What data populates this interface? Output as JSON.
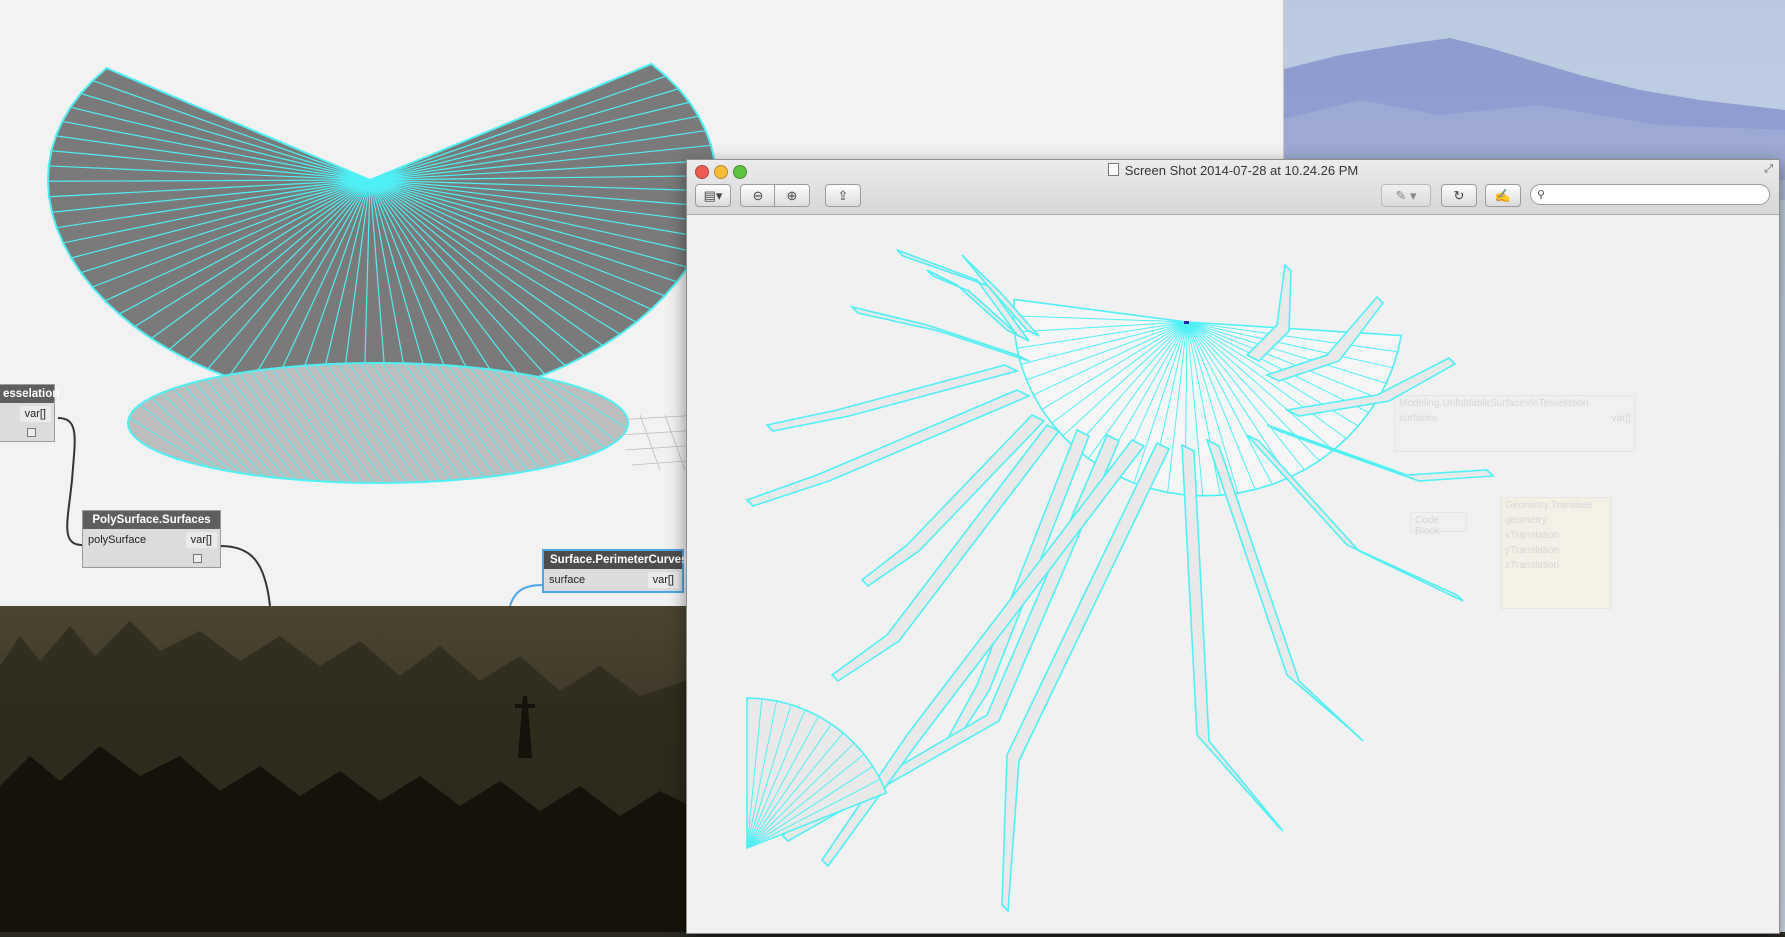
{
  "dynamo": {
    "nodes": {
      "tesselation": {
        "title": "esselation",
        "output": "var[]"
      },
      "polysurface": {
        "title": "PolySurface.Surfaces",
        "input": "polySurface",
        "output": "var[]"
      },
      "perimeter": {
        "title": "Surface.PerimeterCurves",
        "input": "surface",
        "output": "var[]"
      }
    }
  },
  "preview": {
    "window_title": "Screen Shot 2014-07-28 at 10.24.26 PM",
    "toolbar": {
      "sidebar_icon": "sidebar-icon",
      "zoom_out_icon": "zoom-out-icon",
      "zoom_in_icon": "zoom-in-icon",
      "share_icon": "share-icon",
      "annotate_icon": "pen-icon",
      "rotate_icon": "rotate-icon",
      "edit_icon": "edit-icon",
      "search_icon": "search-icon",
      "search_placeholder": ""
    },
    "ghost_labels": {
      "node1": "Modeling.UnfoldableSurfaceVisTesselation",
      "node1_port": "surfaces",
      "node1_out": "var[]",
      "node2": "Code Block",
      "node3": "Geometry.Translate",
      "node3_p1": "geometry",
      "node3_p2": "xTranslation",
      "node3_p3": "yTranslation",
      "node3_p4": "zTranslation"
    }
  },
  "colors": {
    "wire": "#4ff0f5",
    "surface_dark": "#7a7a7a",
    "surface_light": "#bdbdbd",
    "preview_fill": "#e9e9e9"
  }
}
